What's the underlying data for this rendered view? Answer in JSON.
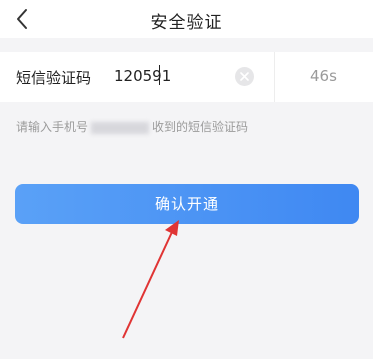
{
  "header": {
    "title": "安全验证",
    "back_icon": "chevron-left-icon"
  },
  "verification": {
    "label": "短信验证码",
    "code_value": "120591",
    "clear_icon": "clear-icon",
    "countdown": "46s"
  },
  "hint": {
    "prefix": "请输入手机号",
    "suffix": "收到的短信验证码"
  },
  "confirm_button": {
    "label": "确认开通",
    "color": "#4a92f4"
  },
  "annotation": {
    "arrow_color": "#e03434"
  }
}
